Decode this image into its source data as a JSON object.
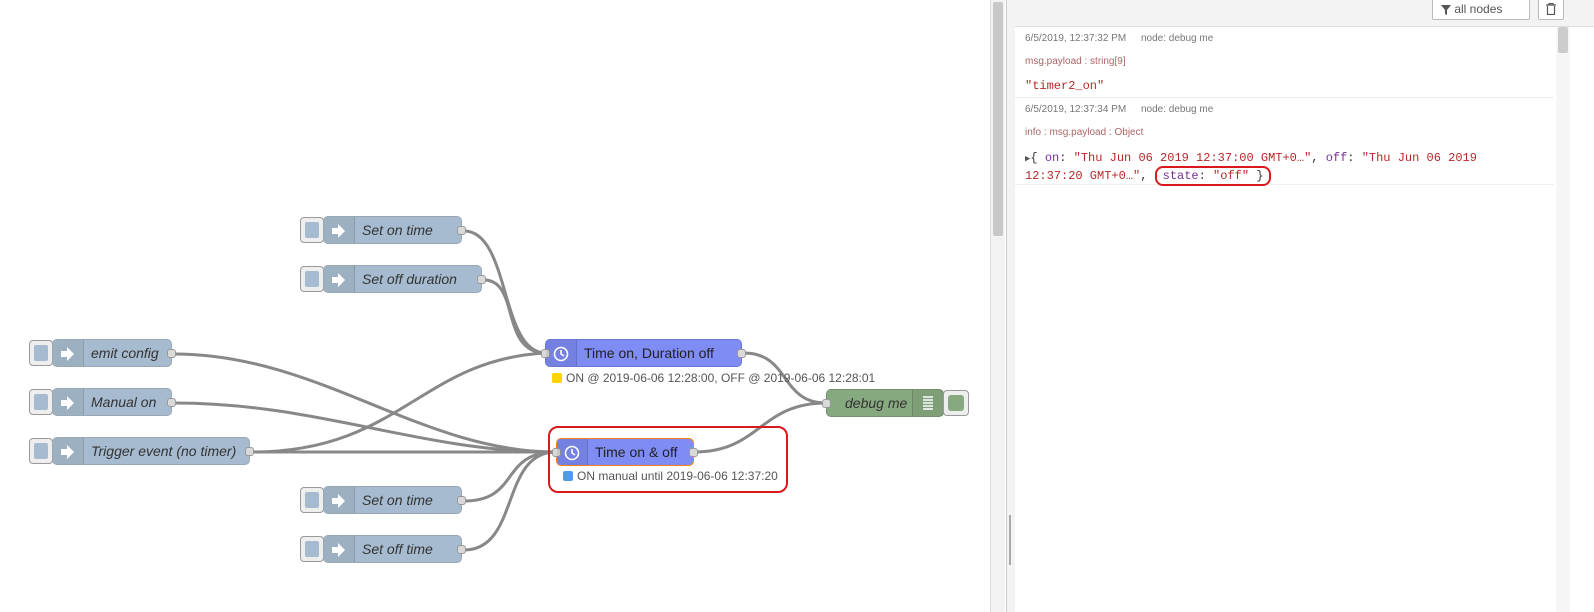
{
  "canvas": {
    "nodes": {
      "set_on_time_1": "Set on time",
      "set_off_duration": "Set off duration",
      "emit_config": "emit config",
      "manual_on": "Manual on",
      "trigger_event": "Trigger event (no timer)",
      "set_on_time_2": "Set on time",
      "set_off_time": "Set off time",
      "timer1": "Time on, Duration off",
      "timer2": "Time on & off",
      "debug": "debug me"
    },
    "status": {
      "timer1": "ON @ 2019-06-06 12:28:00, OFF @ 2019-06-06 12:28:01",
      "timer2": "ON manual until 2019-06-06 12:37:20"
    },
    "colors": {
      "inject": "#a6bbcf",
      "timer": "#7e8cf4",
      "debug": "#87a980",
      "status_yellow": "#ffd400",
      "status_blue": "#4f9de8",
      "highlight": "#d9191c"
    },
    "icons": {
      "inject": "arrow-in-icon",
      "timer": "clock-icon",
      "debug": "list-icon"
    }
  },
  "sidebar": {
    "filter_label": "all nodes",
    "trash_icon": "trash-icon",
    "messages": [
      {
        "timestamp": "6/5/2019, 12:37:32 PM",
        "node": "node: debug me",
        "topic": "msg.payload : string[9]",
        "value": "\"timer2_on\""
      },
      {
        "timestamp": "6/5/2019, 12:37:34 PM",
        "node": "node: debug me",
        "topic": "info : msg.payload : Object",
        "obj": {
          "open_brace": "{ ",
          "on_key": "on",
          "on_val": "\"Thu Jun 06 2019 12:37:00 GMT+0…\"",
          "off_key": "off",
          "off_val_1": "\"Thu Jun 06 2019",
          "off_val_2": "12:37:20 GMT+0…\"",
          "state_key": "state",
          "state_val": "\"off\"",
          "close_brace": " }"
        }
      }
    ]
  }
}
